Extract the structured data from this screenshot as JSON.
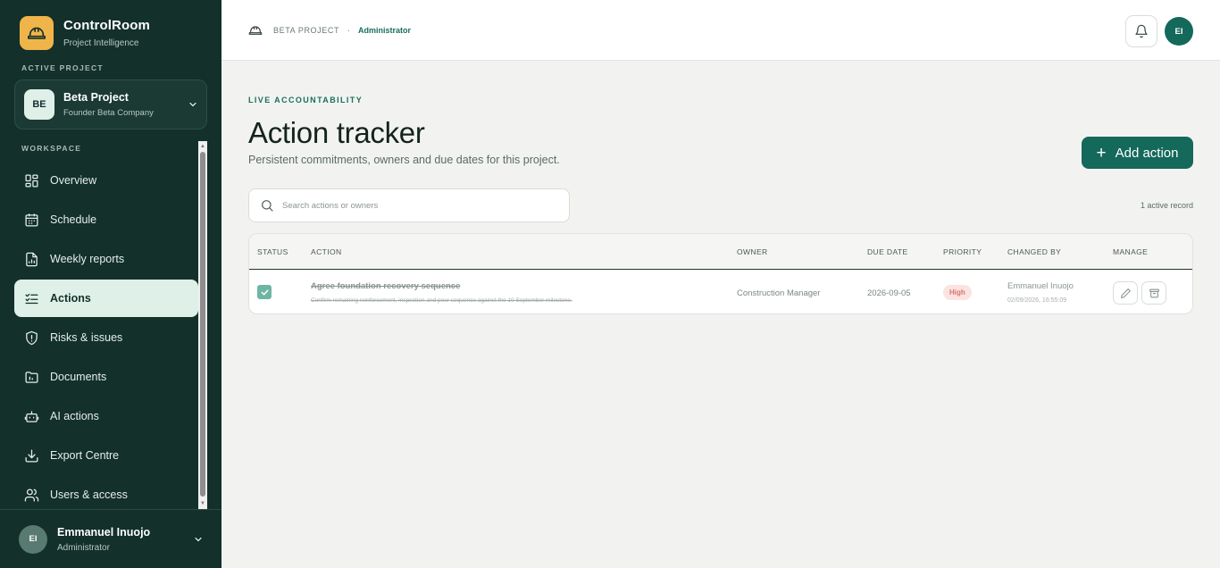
{
  "brand": {
    "name": "ControlRoom",
    "subtitle": "Project Intelligence"
  },
  "sidebar": {
    "active_project_label": "ACTIVE PROJECT",
    "project": {
      "initials": "BE",
      "name": "Beta Project",
      "company": "Founder Beta Company"
    },
    "workspace_label": "WORKSPACE",
    "items": [
      {
        "label": "Overview",
        "icon": "grid-icon"
      },
      {
        "label": "Schedule",
        "icon": "calendar-icon"
      },
      {
        "label": "Weekly reports",
        "icon": "report-chart-icon"
      },
      {
        "label": "Actions",
        "icon": "checklist-icon",
        "active": true
      },
      {
        "label": "Risks & issues",
        "icon": "shield-icon"
      },
      {
        "label": "Documents",
        "icon": "folder-icon"
      },
      {
        "label": "AI actions",
        "icon": "robot-icon"
      },
      {
        "label": "Export Centre",
        "icon": "download-icon"
      },
      {
        "label": "Users & access",
        "icon": "users-icon"
      }
    ],
    "user": {
      "initials": "EI",
      "name": "Emmanuel Inuojo",
      "role": "Administrator"
    }
  },
  "header": {
    "breadcrumb_project": "BETA PROJECT",
    "breadcrumb_separator": "·",
    "breadcrumb_role": "Administrator",
    "avatar_initials": "EI"
  },
  "main": {
    "eyebrow": "LIVE ACCOUNTABILITY",
    "title": "Action tracker",
    "subtitle": "Persistent commitments, owners and due dates for this project.",
    "add_button_label": "Add action",
    "search_placeholder": "Search actions or owners",
    "record_count": "1 active record"
  },
  "table": {
    "columns": [
      "STATUS",
      "ACTION",
      "OWNER",
      "DUE DATE",
      "PRIORITY",
      "CHANGED BY",
      "MANAGE"
    ],
    "rows": [
      {
        "done": true,
        "title": "Agree foundation recovery sequence",
        "description": "Confirm remaining reinforcement, inspection and pour sequence against the 10 September milestone.",
        "owner": "Construction Manager",
        "due_date": "2026-09-05",
        "priority": "High",
        "changed_by": "Emmanuel Inuojo",
        "changed_at": "02/09/2026, 16:55:09"
      }
    ]
  },
  "colors": {
    "sidebar_bg": "#13302a",
    "accent": "#14695b",
    "brand_logo": "#f0b54a",
    "priority_high_bg": "#fbe3e1",
    "priority_high_text": "#d9756d",
    "done_checkbox": "#6fb5a3"
  }
}
